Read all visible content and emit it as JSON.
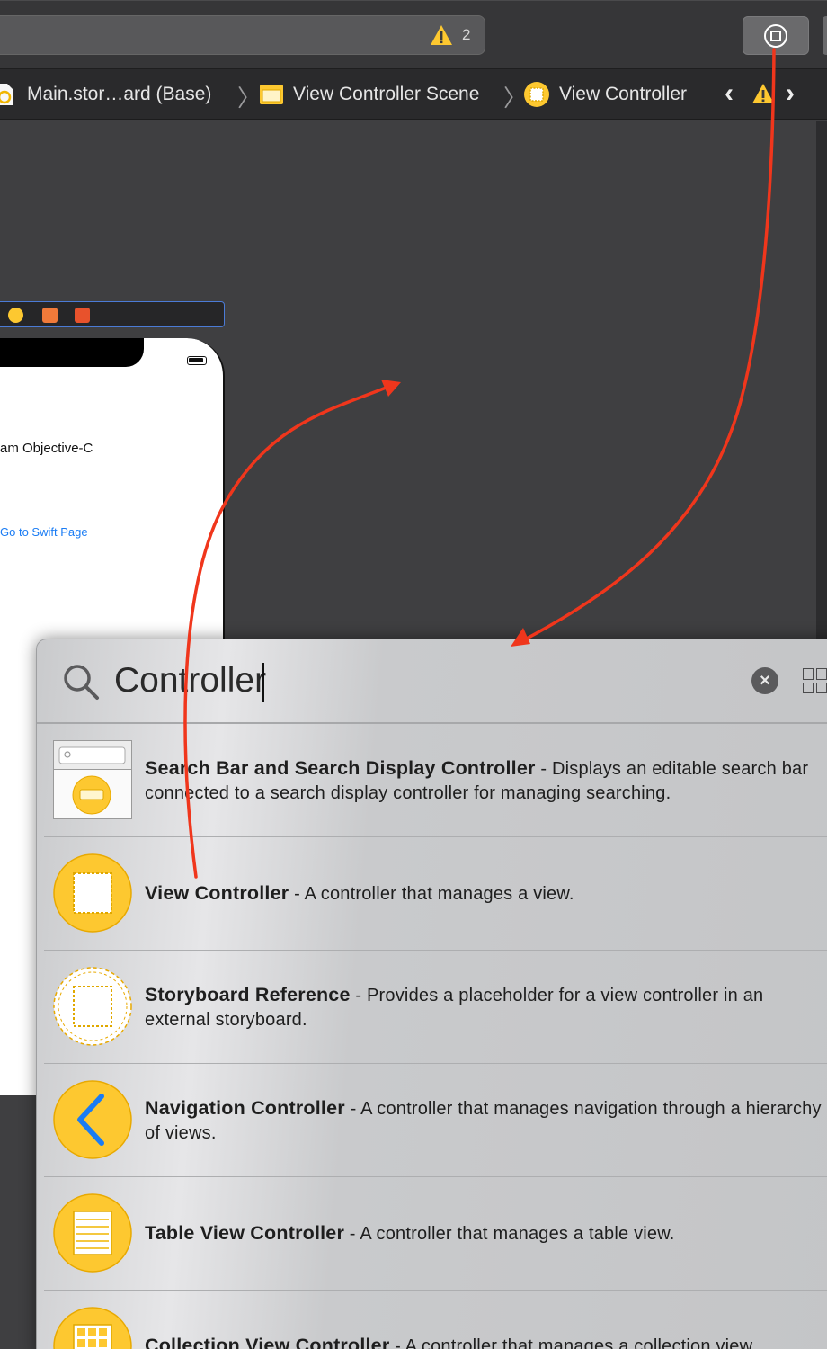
{
  "toolbar": {
    "warning_count": "2"
  },
  "jumpbar": {
    "crumbs": [
      "Main.stor…ard (Base)",
      "View Controller Scene",
      "View Controller"
    ]
  },
  "phone": {
    "label_text": "am Objective-C",
    "link_text": "Go to Swift Page"
  },
  "library": {
    "search": {
      "value": "Controller"
    },
    "clear_label": "×",
    "items": [
      {
        "title": "Search Bar and Search Display Controller",
        "desc": " - Displays an editable search bar connected to a search display controller for managing searching."
      },
      {
        "title": "View Controller",
        "desc": " - A controller that manages a view."
      },
      {
        "title": "Storyboard Reference",
        "desc": " - Provides a placeholder for a view controller in an external storyboard."
      },
      {
        "title": "Navigation Controller",
        "desc": " - A controller that manages navigation through a hierarchy of views."
      },
      {
        "title": "Table View Controller",
        "desc": " - A controller that manages a table view."
      },
      {
        "title": "Collection View Controller",
        "desc": " - A controller that manages a collection view."
      }
    ]
  },
  "colors": {
    "accent_yellow": "#fdc830",
    "annotation_red": "#f0361c",
    "link_blue": "#1a7cf4"
  }
}
